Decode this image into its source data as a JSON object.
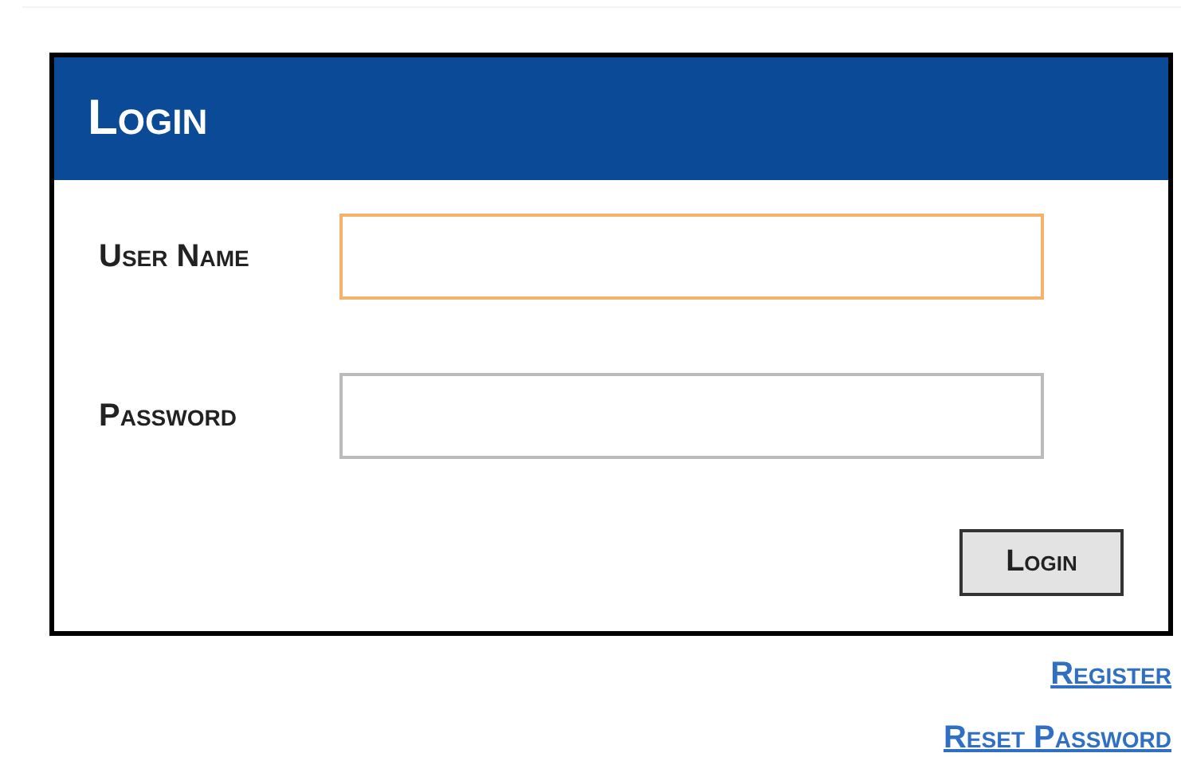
{
  "panel": {
    "title": "Login"
  },
  "fields": [
    {
      "label": "User Name",
      "focused": true
    },
    {
      "label": "Password",
      "focused": false
    }
  ],
  "button": "Login",
  "links": [
    "Register",
    "Reset Password"
  ]
}
